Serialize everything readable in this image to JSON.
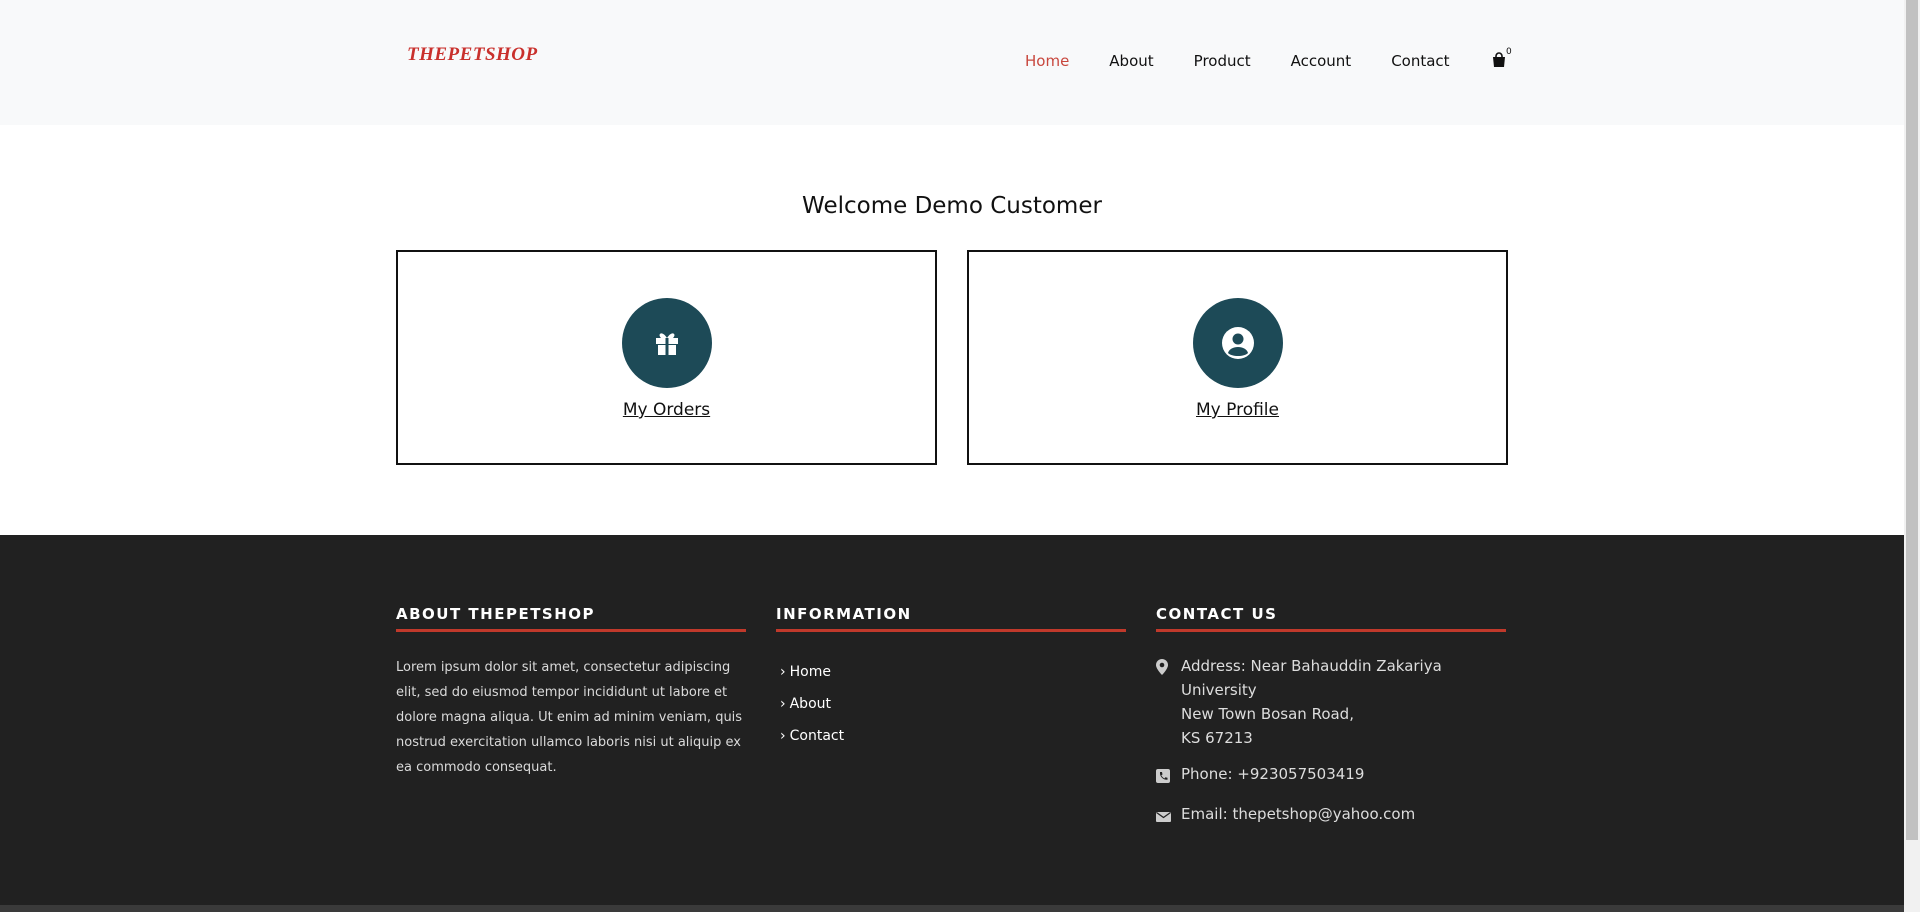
{
  "header": {
    "logo": "THEPETSHOP",
    "nav": [
      {
        "label": "Home",
        "active": true
      },
      {
        "label": "About",
        "active": false
      },
      {
        "label": "Product",
        "active": false
      },
      {
        "label": "Account",
        "active": false
      },
      {
        "label": "Contact",
        "active": false
      }
    ],
    "cart_icon": "shopping-bag-icon",
    "cart_count": "0"
  },
  "main": {
    "welcome": "Welcome Demo Customer",
    "cards": [
      {
        "label": "My Orders",
        "icon": "gift-icon"
      },
      {
        "label": "My Profile",
        "icon": "user-circle-icon"
      }
    ]
  },
  "footer": {
    "about": {
      "title": "ABOUT THEPETSHOP",
      "text": "Lorem ipsum dolor sit amet, consectetur adipiscing elit, sed do eiusmod tempor incididunt ut labore et dolore magna aliqua. Ut enim ad minim veniam, quis nostrud exercitation ullamco laboris nisi ut aliquip ex ea commodo consequat."
    },
    "information": {
      "title": "INFORMATION",
      "links": [
        "Home",
        "About",
        "Contact"
      ]
    },
    "contact": {
      "title": "CONTACT US",
      "address_lines": [
        "Address: Near Bahauddin Zakariya",
        "University",
        "New Town Bosan Road,",
        "KS 67213"
      ],
      "phone": "Phone: +923057503419",
      "email": "Email: thepetshop@yahoo.com"
    }
  },
  "colors": {
    "accent": "#c8473d",
    "icon_circle": "#1d4a57",
    "footer_bg": "#212121",
    "header_bg": "#f8f9fa"
  }
}
